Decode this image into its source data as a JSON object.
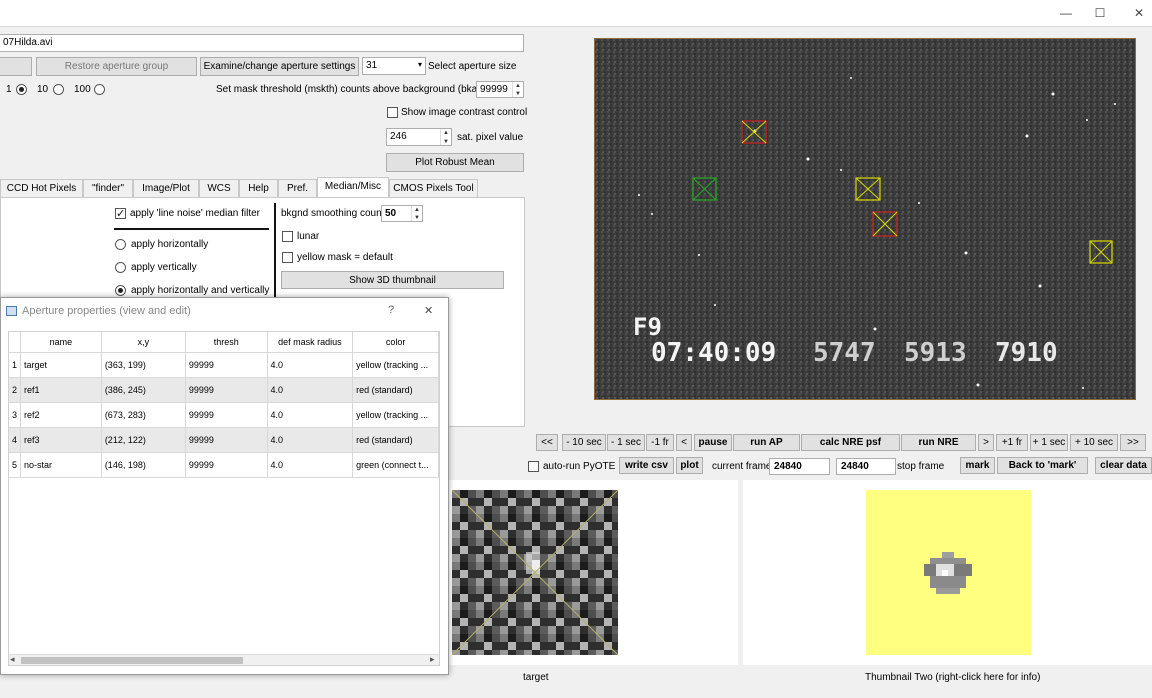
{
  "window": {
    "file_name": "07Hilda.avi",
    "minimize": "—",
    "maximize": "☐",
    "close": "✕"
  },
  "top": {
    "restore_label": "Restore aperture group",
    "examine_label": "Examine/change aperture settings",
    "aperture_size_value": "31",
    "select_aperture_label": "Select aperture size",
    "radio_1": "1",
    "radio_10": "10",
    "radio_100": "100",
    "mask_threshold_label": "Set mask threshold (mskth) counts above background (bkavg)",
    "mask_threshold_value": "99999",
    "contrast_label": "Show image contrast control",
    "sat_value": "246",
    "sat_label": "sat. pixel value",
    "robust_mean_label": "Plot Robust Mean"
  },
  "tabs": [
    {
      "label": "CCD Hot Pixels"
    },
    {
      "label": "\"finder\""
    },
    {
      "label": "Image/Plot"
    },
    {
      "label": "WCS"
    },
    {
      "label": "Help"
    },
    {
      "label": "Pref."
    },
    {
      "label": "Median/Misc"
    },
    {
      "label": "CMOS Pixels Tool"
    }
  ],
  "median_panel": {
    "line_noise_label": "apply 'line noise' median filter",
    "horizontally": "apply horizontally",
    "vertically": "apply vertically",
    "both": "apply horizontally and vertically",
    "bkgnd_label": "bkgnd smoothing count",
    "bkgnd_value": "50",
    "lunar_label": "lunar",
    "yellow_mask_label": "yellow mask = default",
    "show3d_label": "Show 3D thumbnail"
  },
  "video": {
    "frame_tag": "F9",
    "timestamp": "07:40:09",
    "counter_a": "5747",
    "counter_b": "5913",
    "counter_c": "7910",
    "aperture_boxes": [
      {
        "name": "target",
        "color": "#d8d800",
        "cross": "#cc2222"
      },
      {
        "name": "no-star",
        "color": "#22aa22",
        "cross": "#22aa22"
      },
      {
        "name": "ref2",
        "color": "#d8d800",
        "cross": "#d8d800"
      },
      {
        "name": "ref1",
        "color": "#cc2222",
        "cross": "#d8d800"
      },
      {
        "name": "ref3",
        "color": "#d8d800",
        "cross": "#d8d800"
      }
    ]
  },
  "controls": {
    "first": "<<",
    "minus10": "- 10 sec",
    "minus1": "- 1 sec",
    "minus1fr": "-1 fr",
    "back": "<",
    "pause": "pause",
    "run_ap": "run AP",
    "calc_nre": "calc NRE psf",
    "run_nre": "run NRE",
    "fwd": ">",
    "plus1fr": "+1 fr",
    "plus1": "+ 1 sec",
    "plus10": "+ 10 sec",
    "last": ">>",
    "autorun_label": "auto-run PyOTE",
    "write_csv": "write csv",
    "plot": "plot",
    "current_frame_label": "current frame",
    "current_frame_value": "24840",
    "stop_frame_value": "24840",
    "stop_frame_label": "stop frame",
    "mark": "mark",
    "back_to_mark": "Back to 'mark'",
    "clear_data": "clear data"
  },
  "thumbnails": {
    "one_label": "target",
    "two_label": "Thumbnail Two (right-click here for info)",
    "two_bg": "#ffff80"
  },
  "dialog": {
    "title": "Aperture properties (view and edit)",
    "help": "?",
    "close": "✕",
    "columns": [
      "name",
      "x,y",
      "thresh",
      "def mask radius",
      "color"
    ],
    "rows": [
      {
        "idx": "1",
        "name": "target",
        "xy": "(363, 199)",
        "thresh": "99999",
        "radius": "4.0",
        "color": "yellow (tracking ..."
      },
      {
        "idx": "2",
        "name": "ref1",
        "xy": "(386, 245)",
        "thresh": "99999",
        "radius": "4.0",
        "color": "red (standard)"
      },
      {
        "idx": "3",
        "name": "ref2",
        "xy": "(673, 283)",
        "thresh": "99999",
        "radius": "4.0",
        "color": "yellow (tracking ..."
      },
      {
        "idx": "4",
        "name": "ref3",
        "xy": "(212, 122)",
        "thresh": "99999",
        "radius": "4.0",
        "color": "red (standard)"
      },
      {
        "idx": "5",
        "name": "no-star",
        "xy": "(146, 198)",
        "thresh": "99999",
        "radius": "4.0",
        "color": "green (connect t..."
      }
    ],
    "scroll_left": "◂",
    "scroll_right": "▸"
  }
}
